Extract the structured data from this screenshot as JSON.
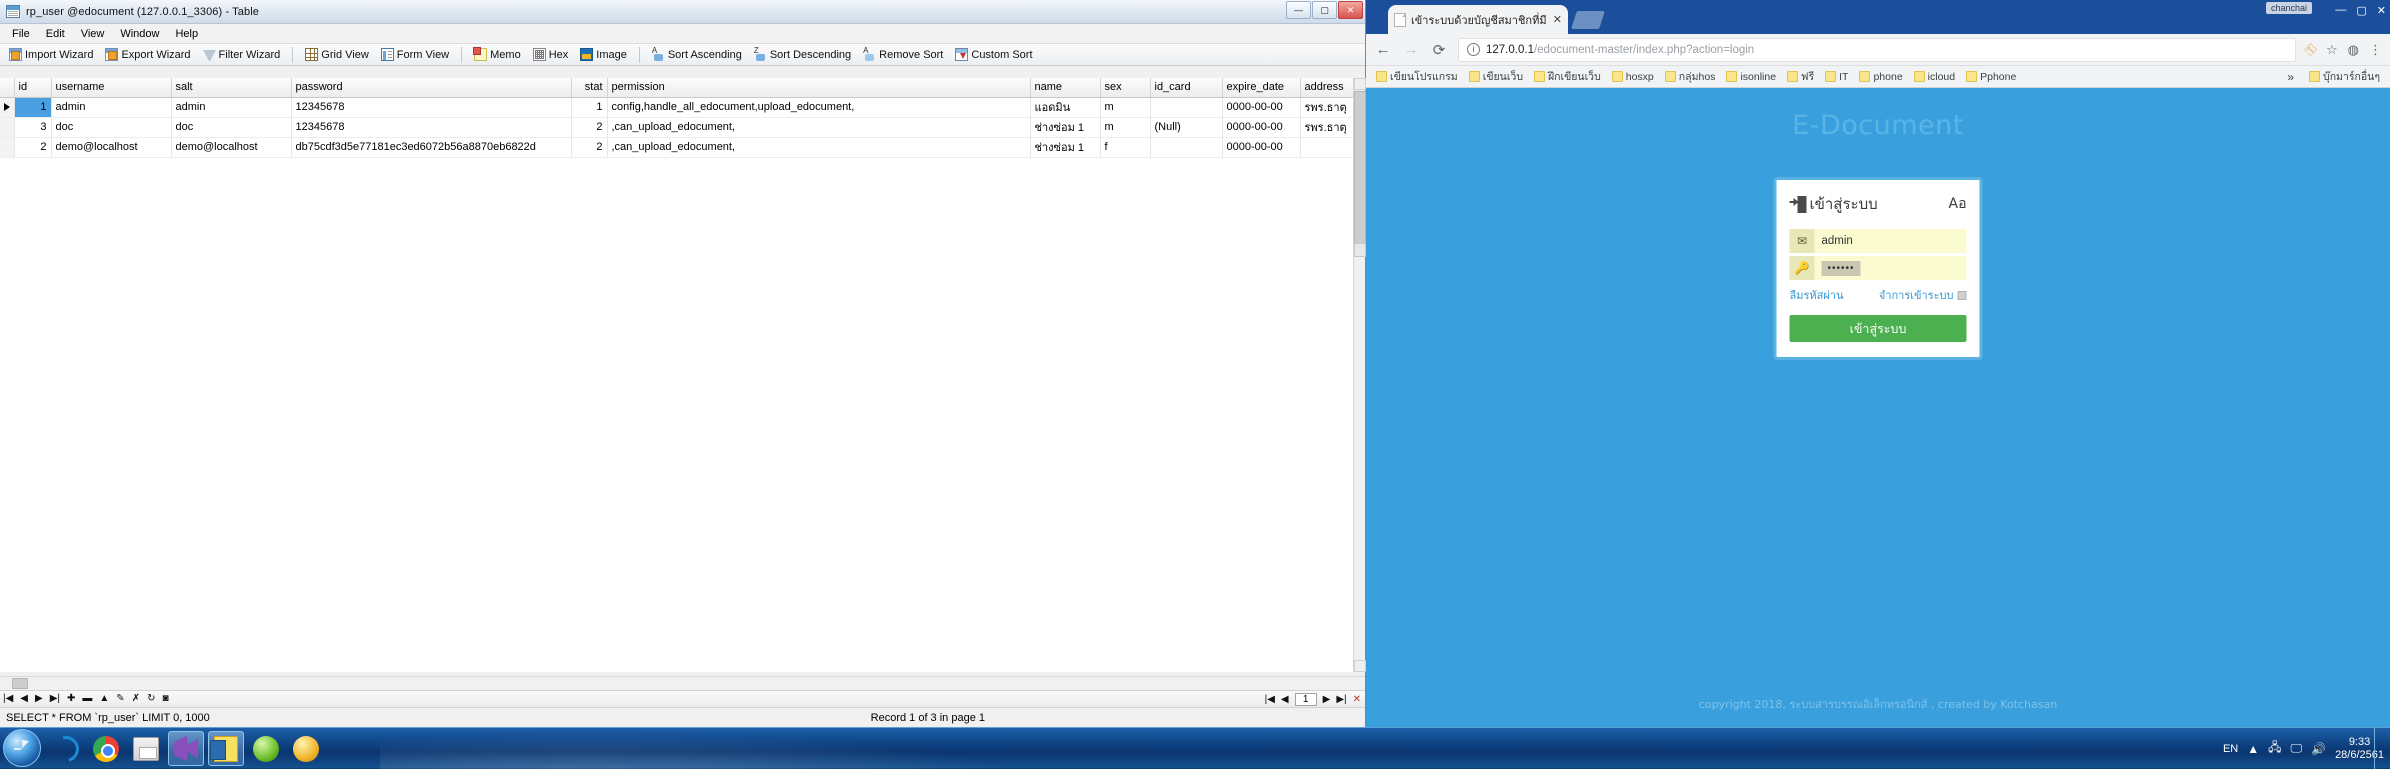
{
  "navicat": {
    "window_title": "rp_user @edocument (127.0.0.1_3306) - Table",
    "window_buttons": {
      "minimize": "—",
      "maximize": "▢",
      "close": "✕"
    },
    "menu": [
      "File",
      "Edit",
      "View",
      "Window",
      "Help"
    ],
    "toolbar": [
      {
        "label": "Import Wizard",
        "icon": "import-wizard-icon"
      },
      {
        "label": "Export Wizard",
        "icon": "export-wizard-icon"
      },
      {
        "label": "Filter Wizard",
        "icon": "filter-wizard-icon"
      },
      {
        "label": "Grid View",
        "icon": "grid-view-icon"
      },
      {
        "label": "Form View",
        "icon": "form-view-icon"
      },
      {
        "label": "Memo",
        "icon": "memo-icon"
      },
      {
        "label": "Hex",
        "icon": "hex-icon"
      },
      {
        "label": "Image",
        "icon": "image-icon"
      },
      {
        "label": "Sort Ascending",
        "icon": "sort-ascending-icon"
      },
      {
        "label": "Sort Descending",
        "icon": "sort-descending-icon"
      },
      {
        "label": "Remove Sort",
        "icon": "remove-sort-icon"
      },
      {
        "label": "Custom Sort",
        "icon": "custom-sort-icon"
      }
    ],
    "grid": {
      "columns": [
        "id",
        "username",
        "salt",
        "password",
        "stat",
        "permission",
        "name",
        "sex",
        "id_card",
        "expire_date",
        "address"
      ],
      "rows": [
        {
          "id": "1",
          "username": "admin",
          "salt": "admin",
          "password": "12345678",
          "stat": "1",
          "permission": "config,handle_all_edocument,upload_edocument,",
          "name": "แอดมิน",
          "sex": "m",
          "id_card": "",
          "expire_date": "0000-00-00",
          "address": "รพร.ธาตุ"
        },
        {
          "id": "3",
          "username": "doc",
          "salt": "doc",
          "password": "12345678",
          "stat": "2",
          "permission": ",can_upload_edocument,",
          "name": "ช่างซ่อม 1",
          "sex": "m",
          "id_card": "(Null)",
          "expire_date": "0000-00-00",
          "address": "รพร.ธาตุ"
        },
        {
          "id": "2",
          "username": "demo@localhost",
          "salt": "demo@localhost",
          "password": "db75cdf3d5e77181ec3ed6072b56a8870eb6822d",
          "stat": "2",
          "permission": ",can_upload_edocument,",
          "name": "ช่างซ่อม 1",
          "sex": "f",
          "id_card": "",
          "expire_date": "0000-00-00",
          "address": ""
        }
      ]
    },
    "record_nav": {
      "first": "|◀",
      "prev": "◀",
      "next": "▶",
      "last": "▶|",
      "add": "✚",
      "delete": "▬",
      "apply": "▲",
      "cancel": "✗",
      "edit": "✎",
      "refresh": "↻",
      "stop": "◙",
      "page_first": "|◀",
      "page_prev": "◀",
      "page_value": "1",
      "page_next": "▶",
      "page_last": "▶|",
      "page_stop": "✕"
    },
    "status": {
      "query": "SELECT * FROM `rp_user` LIMIT 0, 1000",
      "record_info": "Record 1 of 3 in page 1"
    }
  },
  "chrome": {
    "tab": {
      "title": "เข้าระบบด้วยบัญชีสมาชิกที่มี",
      "close": "✕",
      "favicon": "page-icon"
    },
    "window_label": "chanchai",
    "window_buttons": {
      "minimize": "—",
      "maximize": "▢",
      "close": "✕"
    },
    "nav": {
      "back": "←",
      "forward": "→",
      "reload": "⟳"
    },
    "omnibox": {
      "info_icon": "ⓘ",
      "url_host": "127.0.0.1",
      "url_path": "/edocument-master/index.php?action=login",
      "url_full": "127.0.0.1/edocument-master/index.php?action=login"
    },
    "toolbar_right": {
      "key": "key-icon",
      "star": "☆",
      "menu": "⋮",
      "profile": "●"
    },
    "bookmarks": [
      "เขียนโปรแกรม",
      "เขียนเว็บ",
      "ฝึกเขียนเว็บ",
      "hosxp",
      "กลุ่มhos",
      "isonline",
      "ฟรี",
      "IT",
      "phone",
      "icloud",
      "Pphone"
    ],
    "bookmarks_overflow": "»",
    "bookmarks_other": "บุ๊กมาร์กอื่นๆ"
  },
  "page": {
    "brand": "E-Document",
    "login": {
      "title": "เข้าสู่ระบบ",
      "title_icon": "login-door-icon",
      "lang_toggle": "Aอ",
      "username": {
        "icon": "envelope-icon",
        "value": "admin",
        "placeholder": ""
      },
      "password": {
        "icon": "key-icon",
        "value": "••••••",
        "placeholder": ""
      },
      "forgot_password": "ลืมรหัสผ่าน",
      "remember_label": "จำการเข้าระบบ",
      "submit": "เข้าสู่ระบบ"
    },
    "footer": "copyright 2018, ระบบสารบรรณอิเล็กทรอนิกส์ , created by Kotchasan"
  },
  "taskbar": {
    "start": "start-orb",
    "items": [
      {
        "name": "internet-explorer",
        "active": false
      },
      {
        "name": "google-chrome",
        "active": false
      },
      {
        "name": "backup-utility",
        "active": false
      },
      {
        "name": "visual-studio",
        "active": true
      },
      {
        "name": "notes-app",
        "active": true
      },
      {
        "name": "green-app",
        "active": false
      },
      {
        "name": "yellow-app",
        "active": false
      }
    ],
    "tray": {
      "language": "EN",
      "show_hidden": "▲",
      "network": "🖧",
      "monitor": "🖵",
      "volume": "🔊",
      "time": "9:33",
      "date": "28/6/2561"
    }
  },
  "colors": {
    "accent_blue": "#3aa0dd",
    "login_button_green": "#4caf50",
    "field_yellow": "#fbfbd2",
    "taskbar_blue": "#0d3f7e",
    "selection_blue": "#4a9fe0"
  }
}
